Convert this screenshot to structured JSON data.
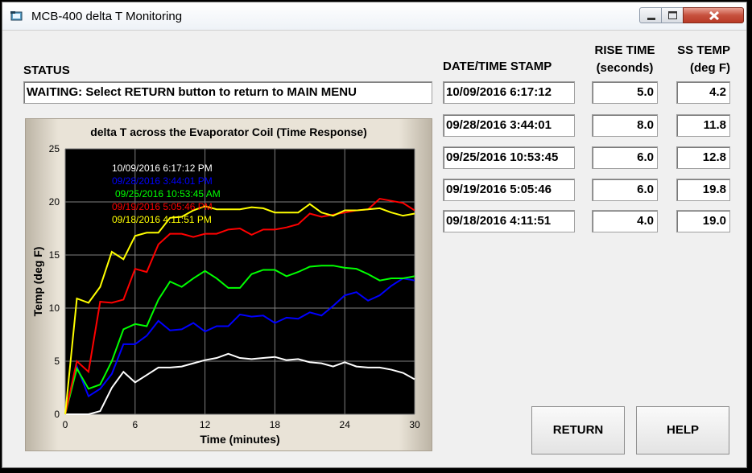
{
  "window": {
    "title": "MCB-400 delta T Monitoring"
  },
  "status": {
    "label": "STATUS",
    "value": "WAITING: Select RETURN button to return to MAIN MENU"
  },
  "table": {
    "col_date": "DATE/TIME STAMP",
    "col_rise_line1": "RISE TIME",
    "col_rise_line2": "(seconds)",
    "col_ss_line1": "SS TEMP",
    "col_ss_line2": "(deg F)",
    "rows": [
      {
        "date": "10/09/2016 6:17:12",
        "rise": "5.0",
        "ss": "4.2"
      },
      {
        "date": "09/28/2016 3:44:01",
        "rise": "8.0",
        "ss": "11.8"
      },
      {
        "date": "09/25/2016 10:53:45",
        "rise": "6.0",
        "ss": "12.8"
      },
      {
        "date": "09/19/2016 5:05:46",
        "rise": "6.0",
        "ss": "19.8"
      },
      {
        "date": "09/18/2016 4:11:51",
        "rise": "4.0",
        "ss": "19.0"
      }
    ]
  },
  "buttons": {
    "return": "RETURN",
    "help": "HELP"
  },
  "chart_data": {
    "type": "line",
    "title": "delta T across the Evaporator Coil (Time Response)",
    "xlabel": "Time (minutes)",
    "ylabel": "Temp (deg F)",
    "xlim": [
      0,
      30
    ],
    "ylim": [
      0,
      25
    ],
    "xticks": [
      0,
      6,
      12,
      18,
      24,
      30
    ],
    "yticks": [
      0,
      5,
      10,
      15,
      20,
      25
    ],
    "grid": true,
    "legend_position": "top-left",
    "x": [
      0,
      1,
      2,
      3,
      4,
      5,
      6,
      7,
      8,
      9,
      10,
      11,
      12,
      13,
      14,
      15,
      16,
      17,
      18,
      19,
      20,
      21,
      22,
      23,
      24,
      25,
      26,
      27,
      28,
      29,
      30
    ],
    "series": [
      {
        "name": "10/09/2016 6:17:12 PM",
        "color": "#ffffff",
        "values": [
          0,
          0,
          0,
          0.3,
          2.5,
          4,
          3,
          3.7,
          4.4,
          4.4,
          4.5,
          4.8,
          5.1,
          5.3,
          5.7,
          5.3,
          5.2,
          5.3,
          5.4,
          5.1,
          5.2,
          4.9,
          4.8,
          4.5,
          4.9,
          4.5,
          4.4,
          4.4,
          4.2,
          3.9,
          3.3
        ]
      },
      {
        "name": "09/28/2016 3:44:01 PM",
        "color": "#0000ff",
        "values": [
          0,
          4.5,
          1.7,
          2.4,
          3.8,
          6.6,
          6.6,
          7.4,
          8.8,
          7.9,
          8,
          8.6,
          7.8,
          8.3,
          8.3,
          9.4,
          9.2,
          9.3,
          8.6,
          9.1,
          9,
          9.6,
          9.3,
          10.2,
          11.2,
          11.5,
          10.7,
          11.2,
          12.1,
          12.8,
          12.6
        ]
      },
      {
        "name": "09/25/2016 10:53:45 AM",
        "color": "#00ff00",
        "values": [
          0,
          4.3,
          2.4,
          2.8,
          5,
          8,
          8.5,
          8.3,
          10.8,
          12.5,
          12,
          12.8,
          13.5,
          12.8,
          11.9,
          11.9,
          13.2,
          13.6,
          13.6,
          13,
          13.4,
          13.9,
          14,
          14,
          13.8,
          13.7,
          13.2,
          12.6,
          12.8,
          12.8,
          13
        ]
      },
      {
        "name": "09/19/2016 5:05:46 PM",
        "color": "#ff0000",
        "values": [
          0,
          5,
          4,
          10.6,
          10.5,
          10.8,
          13.7,
          13.4,
          16,
          17,
          17,
          16.7,
          17,
          17,
          17.4,
          17.5,
          16.9,
          17.4,
          17.4,
          17.6,
          17.9,
          18.9,
          18.6,
          18.8,
          19,
          19.2,
          19.3,
          20.3,
          20.1,
          19.9,
          19.2
        ]
      },
      {
        "name": "09/18/2016 4:11:51 PM",
        "color": "#ffff00",
        "values": [
          0,
          10.9,
          10.5,
          12,
          15.3,
          14.6,
          16.8,
          17.1,
          17.1,
          18.5,
          18.6,
          19.2,
          19.6,
          19.3,
          19.3,
          19.3,
          19.5,
          19.4,
          19,
          19,
          19,
          19.8,
          19,
          18.7,
          19.2,
          19.2,
          19.3,
          19.4,
          19,
          18.7,
          18.9
        ]
      }
    ]
  }
}
